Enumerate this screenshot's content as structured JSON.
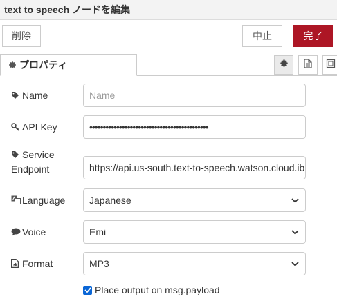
{
  "header": {
    "title": "text to speech ノードを編集"
  },
  "toolbar": {
    "delete_label": "削除",
    "cancel_label": "中止",
    "done_label": "完了"
  },
  "tabs": {
    "properties_label": "プロパティ"
  },
  "form": {
    "name": {
      "label": "Name",
      "placeholder": "Name",
      "value": ""
    },
    "apikey": {
      "label": "API Key",
      "value": "••••••••••••••••••••••••••••••••••••••••••••"
    },
    "endpoint": {
      "label_line1": "Service",
      "label_line2": "Endpoint",
      "value": "https://api.us-south.text-to-speech.watson.cloud.ibm.com"
    },
    "language": {
      "label": "Language",
      "value": "Japanese"
    },
    "voice": {
      "label": "Voice",
      "value": "Emi"
    },
    "format": {
      "label": "Format",
      "value": "MP3"
    },
    "output": {
      "label": "Place output on msg.payload",
      "checked": true
    }
  },
  "colors": {
    "done_button": "#ad1625",
    "checkbox": "#0a66d6"
  }
}
